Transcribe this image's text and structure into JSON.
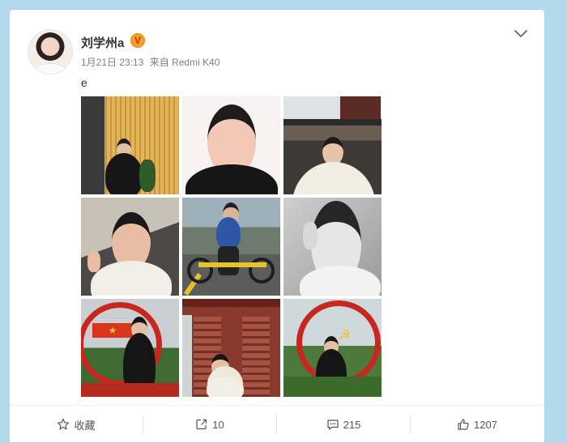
{
  "post": {
    "author": "刘学州a",
    "verified_badge": "V",
    "time": "1月21日 23:13",
    "source_prefix": "来自",
    "device": "Redmi K40",
    "text": "e",
    "photos": [
      {
        "label": "photo-1",
        "desc": "standing by wooden wall"
      },
      {
        "label": "photo-2",
        "desc": "portrait white background"
      },
      {
        "label": "photo-3",
        "desc": "holding folding fan"
      },
      {
        "label": "photo-4",
        "desc": "selfie in car"
      },
      {
        "label": "photo-5",
        "desc": "riding bike"
      },
      {
        "label": "photo-6",
        "desc": "black and white portrait"
      },
      {
        "label": "photo-7",
        "desc": "red emblem sign"
      },
      {
        "label": "photo-8",
        "desc": "red pavilion with fan"
      },
      {
        "label": "photo-9",
        "desc": "red emblem circle"
      }
    ]
  },
  "actions": {
    "favorite_label": "收藏",
    "repost_count": "10",
    "comment_count": "215",
    "like_count": "1207"
  },
  "colors": {
    "page_bg": "#b3d9ee",
    "badge_orange": "#f4a028",
    "badge_red": "#d8281c",
    "text_primary": "#333333",
    "text_secondary": "#808080"
  }
}
